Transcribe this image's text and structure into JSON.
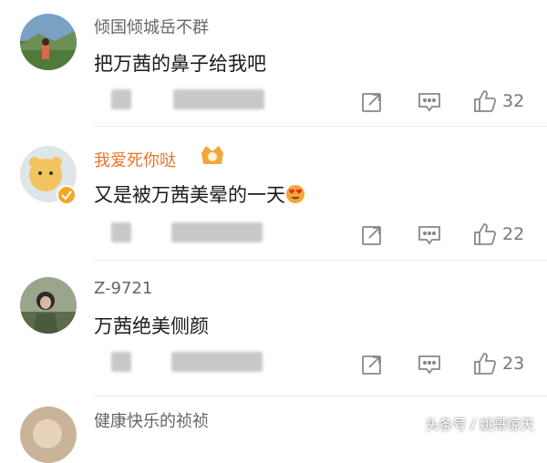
{
  "comments": [
    {
      "username": "倾国倾城岳不群",
      "text": "把万茜的鼻子给我吧",
      "like_count": "32",
      "icons": [
        "share-icon",
        "comment-icon",
        "like-icon"
      ]
    },
    {
      "username": "我爱死你哒",
      "text": "又是被万茜美晕的一天",
      "like_count": "22",
      "icons": [
        "share-icon",
        "comment-icon",
        "like-icon"
      ]
    },
    {
      "username": "Z-9721",
      "text": "万茜绝美侧颜",
      "like_count": "23",
      "icons": [
        "share-icon",
        "comment-icon",
        "like-icon"
      ]
    },
    {
      "username": "健康快乐的祯祯",
      "text": ""
    }
  ],
  "watermark": "头条号 / 姚哥惊天",
  "colors": {
    "vip_name": "#e8742a",
    "normal_name": "#666666",
    "icon": "#888888"
  }
}
